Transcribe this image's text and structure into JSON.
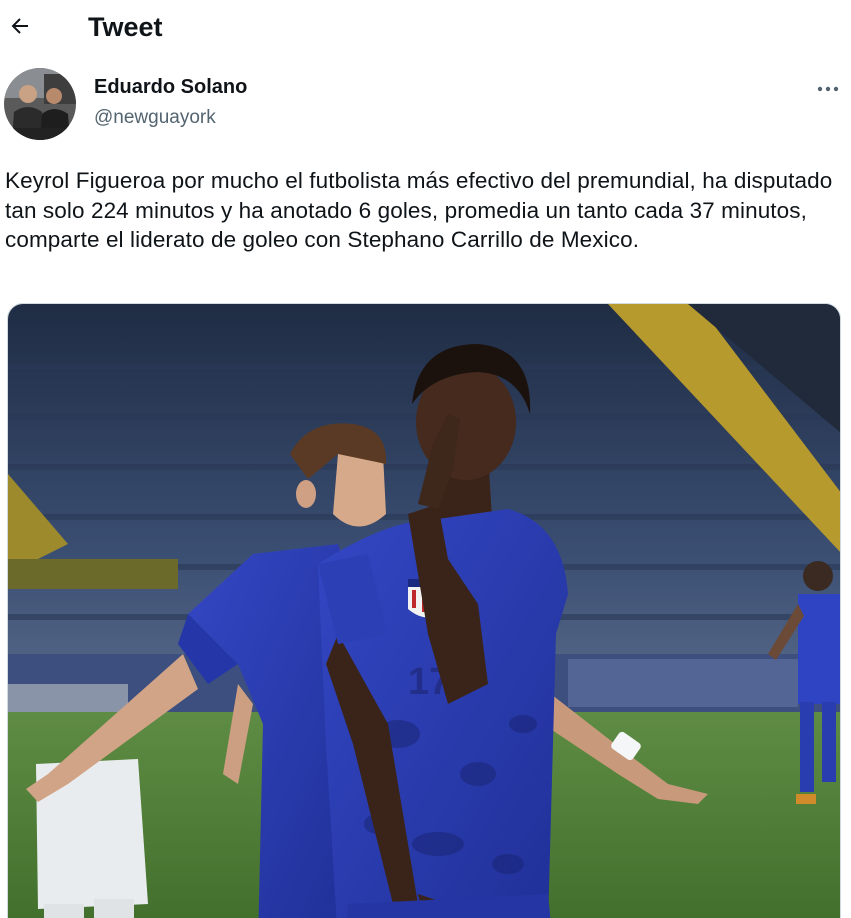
{
  "header": {
    "back_icon": "arrow-left-icon",
    "title": "Tweet"
  },
  "author": {
    "display_name": "Eduardo Solano",
    "handle": "@newguayork",
    "avatar_icon": "avatar"
  },
  "more_icon": "more-horizontal-icon",
  "tweet": {
    "text": "Keyrol Figueroa por mucho el futbolista más efectivo del premundial, ha disputado tan solo 224 minutos y ha anotado 6 goles, promedia un tanto cada 37 minutos, comparte el liderato de goleo con Stephano Carrillo de Mexico."
  },
  "media": {
    "jersey_number": "17"
  },
  "colors": {
    "text": "#0f1419",
    "secondary": "#536471",
    "kit_blue": "#2c3fb0",
    "pitch_green": "#4f7f36"
  }
}
